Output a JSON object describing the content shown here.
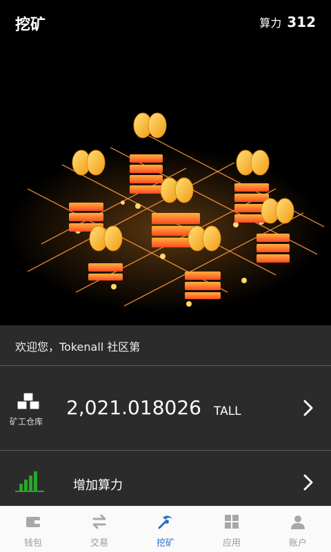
{
  "header": {
    "title": "挖矿",
    "hashrate_label": "算力",
    "hashrate_value": "312"
  },
  "notice": {
    "text": "欢迎您，Tokenall 社区第"
  },
  "warehouse": {
    "label": "矿工仓库",
    "balance": "2,021.018026",
    "unit": "TALL"
  },
  "add_hashrate": {
    "label": "增加算力"
  },
  "tabs": [
    {
      "label": "钱包",
      "icon": "wallet-icon"
    },
    {
      "label": "交易",
      "icon": "exchange-icon"
    },
    {
      "label": "挖矿",
      "icon": "pickaxe-icon",
      "active": true
    },
    {
      "label": "应用",
      "icon": "apps-icon"
    },
    {
      "label": "账户",
      "icon": "user-icon"
    }
  ],
  "colors": {
    "accent": "#2f6fc8",
    "panel": "#2b2b2b",
    "green": "#2aa52a",
    "orange": "#ff8a1e",
    "gold": "#f5b32e"
  }
}
